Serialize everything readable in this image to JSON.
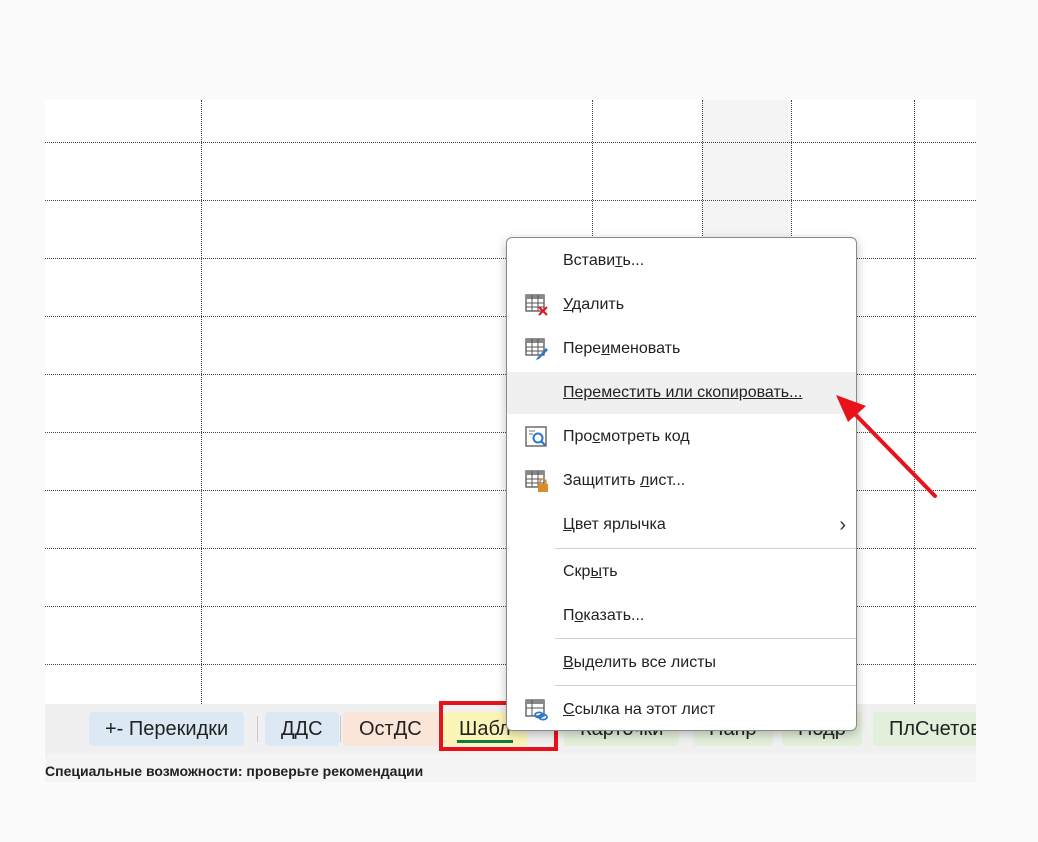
{
  "sheet_tabs": [
    {
      "label": "+- Перекидки",
      "color": "#dce9f5"
    },
    {
      "label": "ДДС",
      "color": "#dce9f5"
    },
    {
      "label": "ОстДС",
      "color": "#fbe5d8"
    },
    {
      "label": "Шабл",
      "color": "#fbf5b8",
      "active": true
    },
    {
      "label": "Карточки",
      "color": "#e2efda"
    },
    {
      "label": "Напр",
      "color": "#e2efda"
    },
    {
      "label": "Подр",
      "color": "#e2efda"
    },
    {
      "label": "ПлСчетов",
      "color": "#e2efda"
    }
  ],
  "status_bar": {
    "accessibility_text": "Специальные возможности: проверьте рекомендации"
  },
  "context_menu": {
    "items": [
      {
        "key": "insert",
        "pre": "Встави",
        "accel": "т",
        "post": "ь...",
        "icon": "none"
      },
      {
        "key": "delete",
        "pre": "",
        "accel": "У",
        "post": "далить",
        "icon": "delete-sheet-icon"
      },
      {
        "key": "rename",
        "pre": "Пере",
        "accel": "и",
        "post": "меновать",
        "icon": "rename-sheet-icon"
      },
      {
        "key": "move_copy",
        "pre": "",
        "accel": "П",
        "post": "ереместить или скопировать...",
        "icon": "none",
        "hovered": true
      },
      {
        "key": "view_code",
        "pre": "Про",
        "accel": "с",
        "post": "мотреть код",
        "icon": "view-code-icon"
      },
      {
        "key": "protect",
        "pre": "Защитить ",
        "accel": "л",
        "post": "ист...",
        "icon": "protect-sheet-icon"
      },
      {
        "key": "tab_color",
        "pre": "",
        "accel": "Ц",
        "post": "вет ярлычка",
        "icon": "none",
        "submenu": true
      },
      {
        "key": "hide",
        "pre": "Скр",
        "accel": "ы",
        "post": "ть",
        "icon": "none"
      },
      {
        "key": "unhide",
        "pre": "П",
        "accel": "о",
        "post": "казать...",
        "icon": "none"
      },
      {
        "key": "select_all",
        "pre": "",
        "accel": "В",
        "post": "ыделить все листы",
        "icon": "none"
      },
      {
        "key": "link",
        "pre": "",
        "accel": "С",
        "post": "сылка на этот лист",
        "icon": "link-sheet-icon"
      }
    ]
  },
  "colors": {
    "annotation_red": "#e8121a",
    "excel_green": "#107c41",
    "icon_blue": "#2b78d0",
    "icon_orange": "#d98c2b"
  }
}
